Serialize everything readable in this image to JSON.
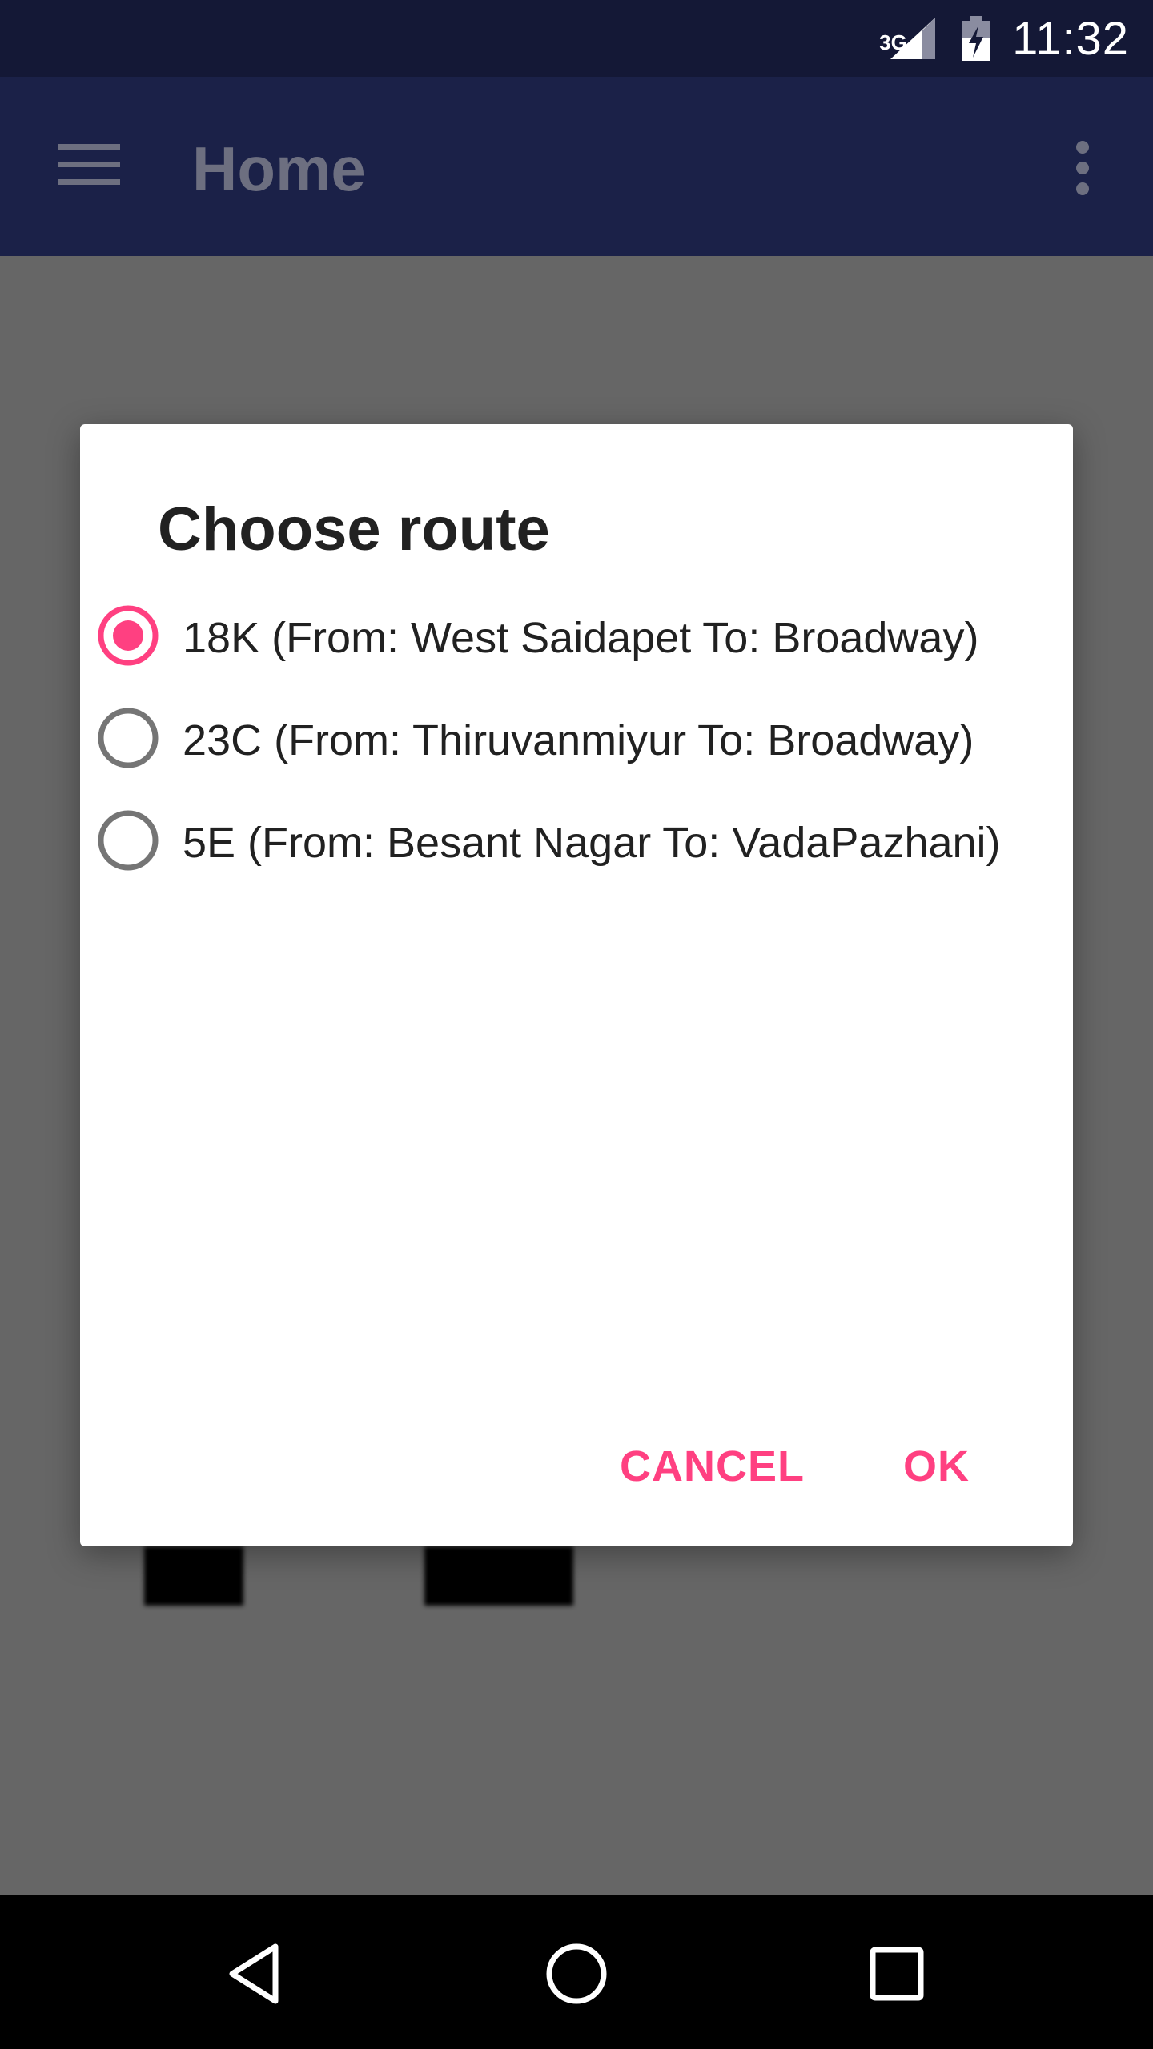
{
  "status_bar": {
    "network": "3G",
    "time": "11:32",
    "icons": [
      "signal-icon",
      "battery-charging-icon"
    ]
  },
  "app_bar": {
    "title": "Home",
    "icons": [
      "menu-icon",
      "overflow-menu-icon"
    ]
  },
  "dialog": {
    "title": "Choose route",
    "options": [
      {
        "label": "18K (From: West Saidapet To: Broadway)",
        "selected": true
      },
      {
        "label": "23C (From: Thiruvanmiyur To: Broadway)",
        "selected": false
      },
      {
        "label": "5E (From: Besant Nagar To: VadaPazhani)",
        "selected": false
      }
    ],
    "cancel_label": "CANCEL",
    "ok_label": "OK"
  },
  "nav_bar": {
    "icons": [
      "back-icon",
      "home-icon",
      "recent-apps-icon"
    ]
  },
  "colors": {
    "status_bar": "#141836",
    "app_bar": "#1b2148",
    "accent": "#ff4081",
    "scrim": "#666666",
    "radio_unchecked": "#757575"
  }
}
